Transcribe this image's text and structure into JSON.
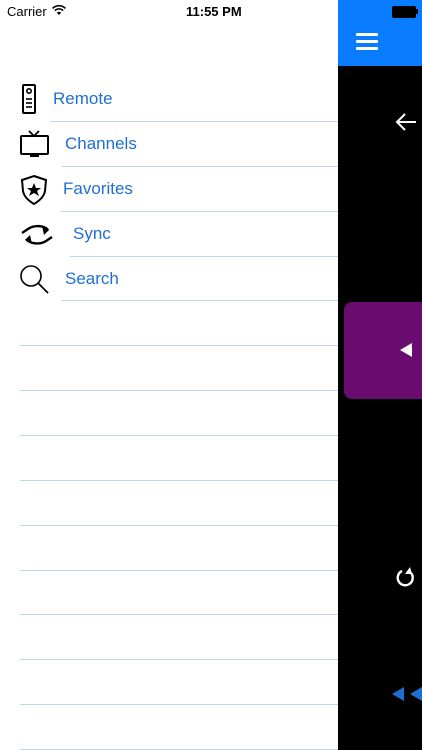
{
  "status_bar": {
    "carrier": "Carrier",
    "time": "11:55 PM"
  },
  "menu": {
    "items": [
      {
        "label": "Remote",
        "icon": "remote-icon"
      },
      {
        "label": "Channels",
        "icon": "tv-icon"
      },
      {
        "label": "Favorites",
        "icon": "star-shield-icon"
      },
      {
        "label": "Sync",
        "icon": "sync-icon"
      },
      {
        "label": "Search",
        "icon": "search-icon"
      }
    ]
  },
  "colors": {
    "accent": "#0a7cff",
    "menu_text": "#1f6fd0",
    "separator": "#bcd6ef",
    "panel_bg": "#000000",
    "purple_button": "#6a0b6f"
  }
}
